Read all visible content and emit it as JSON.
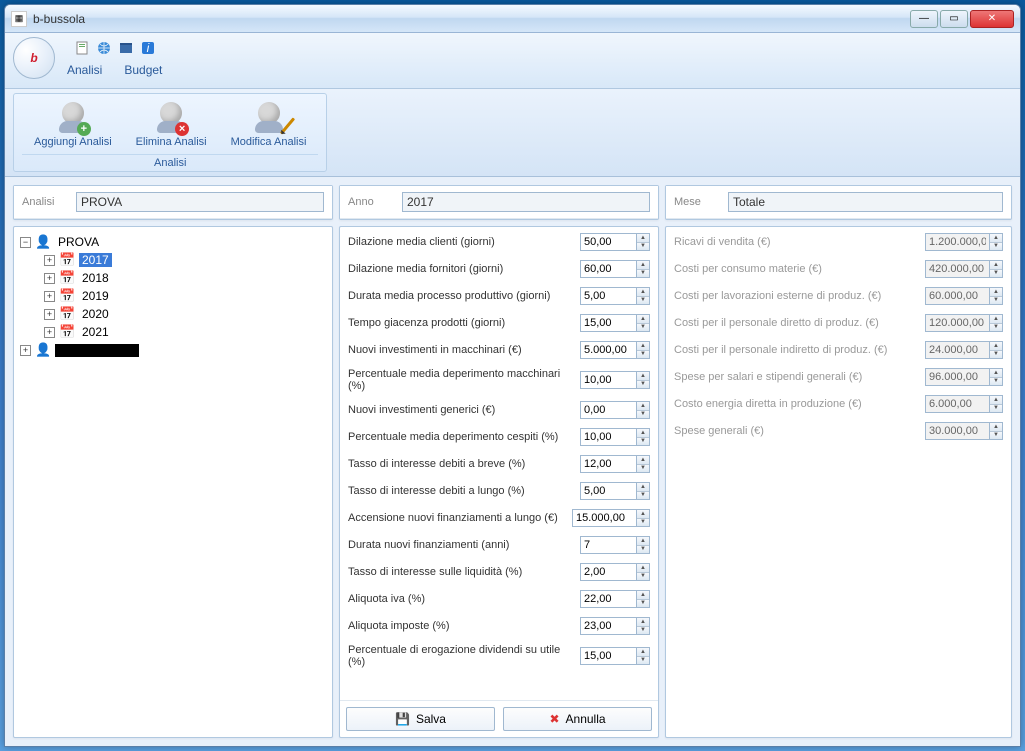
{
  "window": {
    "title": "b-bussola",
    "icon_letter": "b"
  },
  "tabs": {
    "analisi": "Analisi",
    "budget": "Budget"
  },
  "ribbon": {
    "group_caption": "Analisi",
    "add": "Aggiungi Analisi",
    "del": "Elimina Analisi",
    "mod": "Modifica Analisi"
  },
  "left": {
    "label": "Analisi",
    "value": "PROVA",
    "tree": {
      "root": "PROVA",
      "years": [
        "2017",
        "2018",
        "2019",
        "2020",
        "2021"
      ],
      "selected": "2017"
    }
  },
  "mid": {
    "label": "Anno",
    "value": "2017",
    "rows": [
      {
        "label": "Dilazione media clienti (giorni)",
        "value": "50,00",
        "w": "normal"
      },
      {
        "label": "Dilazione media fornitori (giorni)",
        "value": "60,00",
        "w": "normal"
      },
      {
        "label": "Durata media processo produttivo (giorni)",
        "value": "5,00",
        "w": "normal"
      },
      {
        "label": "Tempo giacenza prodotti (giorni)",
        "value": "15,00",
        "w": "normal"
      },
      {
        "label": "Nuovi investimenti in macchinari (€)",
        "value": "5.000,00",
        "w": "normal"
      },
      {
        "label": "Percentuale media deperimento macchinari (%)",
        "value": "10,00",
        "w": "normal"
      },
      {
        "label": "Nuovi investimenti generici (€)",
        "value": "0,00",
        "w": "normal"
      },
      {
        "label": "Percentuale media deperimento cespiti (%)",
        "value": "10,00",
        "w": "normal"
      },
      {
        "label": "Tasso di interesse debiti a breve (%)",
        "value": "12,00",
        "w": "normal"
      },
      {
        "label": "Tasso di interesse debiti a lungo (%)",
        "value": "5,00",
        "w": "normal"
      },
      {
        "label": "Accensione nuovi finanziamenti a lungo (€)",
        "value": "15.000,00",
        "w": "wide"
      },
      {
        "label": "Durata nuovi finanziamenti (anni)",
        "value": "7",
        "w": "normal"
      },
      {
        "label": "Tasso di interesse sulle liquidità (%)",
        "value": "2,00",
        "w": "normal"
      },
      {
        "label": "Aliquota iva (%)",
        "value": "22,00",
        "w": "normal"
      },
      {
        "label": "Aliquota imposte (%)",
        "value": "23,00",
        "w": "normal"
      },
      {
        "label": "Percentuale di erogazione dividendi su utile (%)",
        "value": "15,00",
        "w": "normal"
      }
    ],
    "save": "Salva",
    "cancel": "Annulla"
  },
  "right": {
    "label": "Mese",
    "value": "Totale",
    "rows": [
      {
        "label": "Ricavi di vendita (€)",
        "value": "1.200.000,0"
      },
      {
        "label": "Costi per consumo materie (€)",
        "value": "420.000,00"
      },
      {
        "label": "Costi per lavorazioni esterne di produz. (€)",
        "value": "60.000,00"
      },
      {
        "label": "Costi per il personale diretto di produz. (€)",
        "value": "120.000,00"
      },
      {
        "label": "Costi per il personale indiretto di produz. (€)",
        "value": "24.000,00"
      },
      {
        "label": "Spese per salari e stipendi generali (€)",
        "value": "96.000,00"
      },
      {
        "label": "Costo energia diretta in produzione (€)",
        "value": "6.000,00"
      },
      {
        "label": "Spese generali (€)",
        "value": "30.000,00"
      }
    ]
  }
}
